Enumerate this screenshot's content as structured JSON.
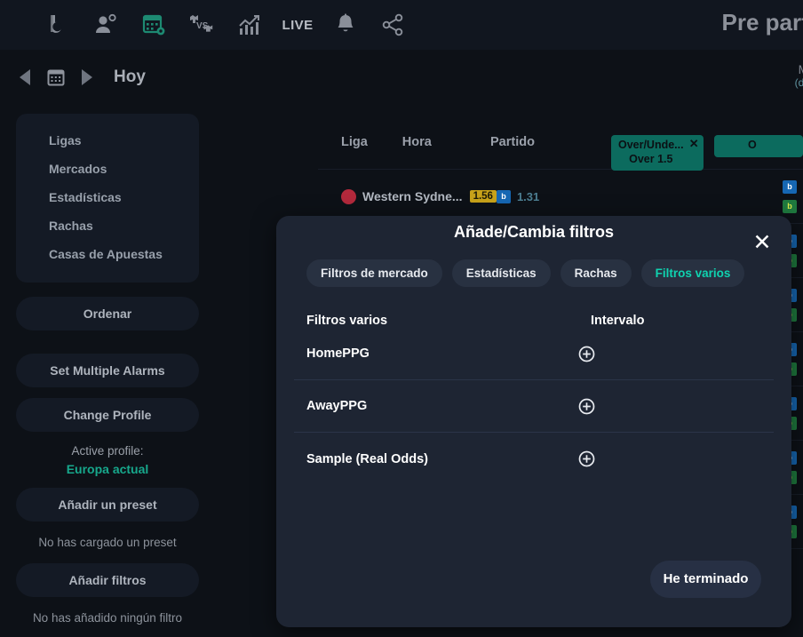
{
  "topbar": {
    "title": "Pre parti",
    "icons": [
      {
        "name": "brand-logo-icon",
        "label": "b"
      },
      {
        "name": "user-settings-icon",
        "label": "user"
      },
      {
        "name": "calendar-settings-icon",
        "label": "calendar"
      },
      {
        "name": "versus-icon",
        "label": "VS"
      },
      {
        "name": "statistics-chart-icon",
        "label": "chart"
      },
      {
        "name": "live-label",
        "label": "LIVE"
      },
      {
        "name": "notifications-bell-icon",
        "label": "bell"
      },
      {
        "name": "share-icon",
        "label": "share"
      }
    ],
    "live_label": "LIVE"
  },
  "datenav": {
    "prev_label": "◀",
    "next_label": "▶",
    "today_label": "Hoy",
    "modalidad_line1": "Mo",
    "modalidad_line2": "(de u"
  },
  "sidebar": {
    "menu": [
      {
        "label": "Ligas"
      },
      {
        "label": "Mercados"
      },
      {
        "label": "Estadísticas"
      },
      {
        "label": "Rachas"
      },
      {
        "label": "Casas de Apuestas"
      }
    ],
    "sort_label": "Ordenar",
    "alarms_label": "Set Multiple Alarms",
    "change_profile_label": "Change Profile",
    "active_profile_caption": "Active profile:",
    "active_profile_value": "Europa actual",
    "add_preset_label": "Añadir un preset",
    "no_preset_text": "No has cargado un preset",
    "add_filters_label": "Añadir filtros",
    "no_filters_text": "No has añadido ningún filtro"
  },
  "table": {
    "headers": {
      "liga": "Liga",
      "hora": "Hora",
      "partido": "Partido"
    },
    "chips": [
      {
        "title": "Over/Unde...",
        "value": "Over 1.5",
        "close": "✕"
      },
      {
        "title": "O",
        "value": "",
        "close": "✕"
      }
    ],
    "rows": [
      {
        "team": "Western Sydne...",
        "odd_badge": "1.56",
        "book_odd": "1.31"
      },
      {
        "team": "",
        "odd_badge": "",
        "book_odd": ""
      },
      {
        "team": "",
        "odd_badge": "",
        "book_odd": ""
      },
      {
        "team": "",
        "odd_badge": "",
        "book_odd": ""
      },
      {
        "team": "",
        "odd_badge": "",
        "book_odd": ""
      },
      {
        "team": "",
        "odd_badge": "",
        "book_odd": ""
      },
      {
        "team": "",
        "odd_badge": "",
        "book_odd": ""
      },
      {
        "team": "",
        "odd_badge": "",
        "book_odd": ""
      }
    ],
    "bookmaker_blue": "b",
    "bookmaker_green": "b"
  },
  "modal": {
    "title": "Añade/Cambia filtros",
    "close_label": "✕",
    "tabs": [
      {
        "label": "Filtros de mercado",
        "active": false
      },
      {
        "label": "Estadísticas",
        "active": false
      },
      {
        "label": "Rachas",
        "active": false
      },
      {
        "label": "Filtros varios",
        "active": true
      }
    ],
    "column_headers": {
      "name": "Filtros varios",
      "interval": "Intervalo"
    },
    "rows": [
      {
        "name": "HomePPG",
        "add_icon": "⊕"
      },
      {
        "name": "AwayPPG",
        "add_icon": "⊕"
      },
      {
        "name": "Sample (Real Odds)",
        "add_icon": "⊕"
      }
    ],
    "done_label": "He terminado"
  },
  "colors": {
    "page_bg": "#0d1117",
    "panel_bg": "#141a25",
    "modal_bg": "#1e2533",
    "accent_teal": "#0fd3b0",
    "profile_teal": "#17a88c",
    "chip_teal": "#0c6b5e",
    "odd_yellow": "#c8a21a"
  }
}
